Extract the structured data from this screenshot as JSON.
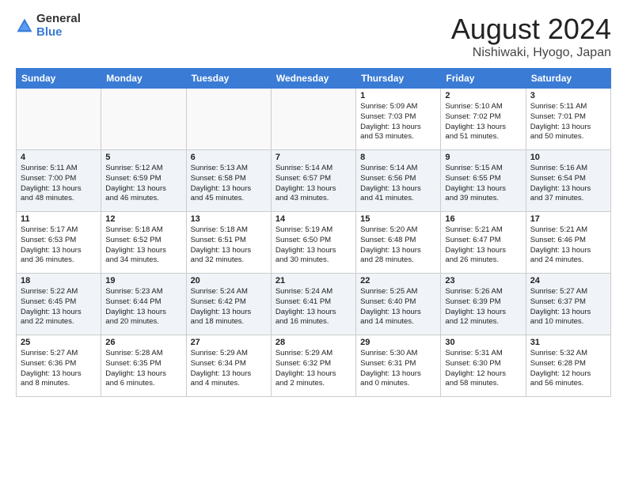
{
  "header": {
    "logo_general": "General",
    "logo_blue": "Blue",
    "month_title": "August 2024",
    "location": "Nishiwaki, Hyogo, Japan"
  },
  "weekdays": [
    "Sunday",
    "Monday",
    "Tuesday",
    "Wednesday",
    "Thursday",
    "Friday",
    "Saturday"
  ],
  "weeks": [
    [
      {
        "day": "",
        "info": ""
      },
      {
        "day": "",
        "info": ""
      },
      {
        "day": "",
        "info": ""
      },
      {
        "day": "",
        "info": ""
      },
      {
        "day": "1",
        "info": "Sunrise: 5:09 AM\nSunset: 7:03 PM\nDaylight: 13 hours\nand 53 minutes."
      },
      {
        "day": "2",
        "info": "Sunrise: 5:10 AM\nSunset: 7:02 PM\nDaylight: 13 hours\nand 51 minutes."
      },
      {
        "day": "3",
        "info": "Sunrise: 5:11 AM\nSunset: 7:01 PM\nDaylight: 13 hours\nand 50 minutes."
      }
    ],
    [
      {
        "day": "4",
        "info": "Sunrise: 5:11 AM\nSunset: 7:00 PM\nDaylight: 13 hours\nand 48 minutes."
      },
      {
        "day": "5",
        "info": "Sunrise: 5:12 AM\nSunset: 6:59 PM\nDaylight: 13 hours\nand 46 minutes."
      },
      {
        "day": "6",
        "info": "Sunrise: 5:13 AM\nSunset: 6:58 PM\nDaylight: 13 hours\nand 45 minutes."
      },
      {
        "day": "7",
        "info": "Sunrise: 5:14 AM\nSunset: 6:57 PM\nDaylight: 13 hours\nand 43 minutes."
      },
      {
        "day": "8",
        "info": "Sunrise: 5:14 AM\nSunset: 6:56 PM\nDaylight: 13 hours\nand 41 minutes."
      },
      {
        "day": "9",
        "info": "Sunrise: 5:15 AM\nSunset: 6:55 PM\nDaylight: 13 hours\nand 39 minutes."
      },
      {
        "day": "10",
        "info": "Sunrise: 5:16 AM\nSunset: 6:54 PM\nDaylight: 13 hours\nand 37 minutes."
      }
    ],
    [
      {
        "day": "11",
        "info": "Sunrise: 5:17 AM\nSunset: 6:53 PM\nDaylight: 13 hours\nand 36 minutes."
      },
      {
        "day": "12",
        "info": "Sunrise: 5:18 AM\nSunset: 6:52 PM\nDaylight: 13 hours\nand 34 minutes."
      },
      {
        "day": "13",
        "info": "Sunrise: 5:18 AM\nSunset: 6:51 PM\nDaylight: 13 hours\nand 32 minutes."
      },
      {
        "day": "14",
        "info": "Sunrise: 5:19 AM\nSunset: 6:50 PM\nDaylight: 13 hours\nand 30 minutes."
      },
      {
        "day": "15",
        "info": "Sunrise: 5:20 AM\nSunset: 6:48 PM\nDaylight: 13 hours\nand 28 minutes."
      },
      {
        "day": "16",
        "info": "Sunrise: 5:21 AM\nSunset: 6:47 PM\nDaylight: 13 hours\nand 26 minutes."
      },
      {
        "day": "17",
        "info": "Sunrise: 5:21 AM\nSunset: 6:46 PM\nDaylight: 13 hours\nand 24 minutes."
      }
    ],
    [
      {
        "day": "18",
        "info": "Sunrise: 5:22 AM\nSunset: 6:45 PM\nDaylight: 13 hours\nand 22 minutes."
      },
      {
        "day": "19",
        "info": "Sunrise: 5:23 AM\nSunset: 6:44 PM\nDaylight: 13 hours\nand 20 minutes."
      },
      {
        "day": "20",
        "info": "Sunrise: 5:24 AM\nSunset: 6:42 PM\nDaylight: 13 hours\nand 18 minutes."
      },
      {
        "day": "21",
        "info": "Sunrise: 5:24 AM\nSunset: 6:41 PM\nDaylight: 13 hours\nand 16 minutes."
      },
      {
        "day": "22",
        "info": "Sunrise: 5:25 AM\nSunset: 6:40 PM\nDaylight: 13 hours\nand 14 minutes."
      },
      {
        "day": "23",
        "info": "Sunrise: 5:26 AM\nSunset: 6:39 PM\nDaylight: 13 hours\nand 12 minutes."
      },
      {
        "day": "24",
        "info": "Sunrise: 5:27 AM\nSunset: 6:37 PM\nDaylight: 13 hours\nand 10 minutes."
      }
    ],
    [
      {
        "day": "25",
        "info": "Sunrise: 5:27 AM\nSunset: 6:36 PM\nDaylight: 13 hours\nand 8 minutes."
      },
      {
        "day": "26",
        "info": "Sunrise: 5:28 AM\nSunset: 6:35 PM\nDaylight: 13 hours\nand 6 minutes."
      },
      {
        "day": "27",
        "info": "Sunrise: 5:29 AM\nSunset: 6:34 PM\nDaylight: 13 hours\nand 4 minutes."
      },
      {
        "day": "28",
        "info": "Sunrise: 5:29 AM\nSunset: 6:32 PM\nDaylight: 13 hours\nand 2 minutes."
      },
      {
        "day": "29",
        "info": "Sunrise: 5:30 AM\nSunset: 6:31 PM\nDaylight: 13 hours\nand 0 minutes."
      },
      {
        "day": "30",
        "info": "Sunrise: 5:31 AM\nSunset: 6:30 PM\nDaylight: 12 hours\nand 58 minutes."
      },
      {
        "day": "31",
        "info": "Sunrise: 5:32 AM\nSunset: 6:28 PM\nDaylight: 12 hours\nand 56 minutes."
      }
    ]
  ]
}
